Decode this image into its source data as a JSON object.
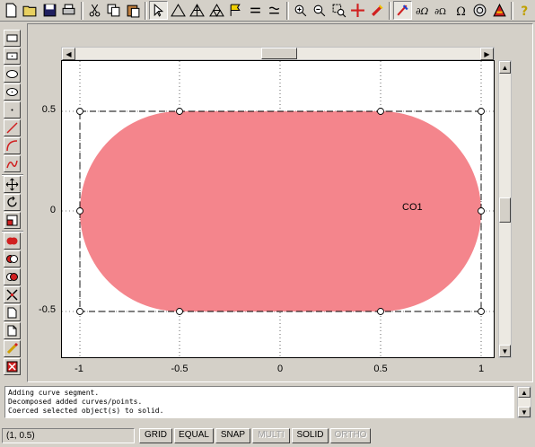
{
  "toolbar": {
    "buttons": [
      "new-icon",
      "open-icon",
      "save-icon",
      "print-icon",
      "cut-icon",
      "copy-icon",
      "paste-icon",
      "select-icon",
      "triangle-icon",
      "triangle-nodes-icon",
      "triangle-refine-icon",
      "flag-icon",
      "equals-icon",
      "approx-equal-icon",
      "zoom-in-icon",
      "zoom-out-icon",
      "zoom-window-icon",
      "cross-arrows-icon",
      "rocket-icon",
      "probe-icon",
      "pde-icon",
      "delta-omega-icon",
      "omega-icon",
      "circle-icon",
      "triangle-flag-icon",
      "help-icon"
    ]
  },
  "left_toolbar": {
    "buttons": [
      "rectangle-icon",
      "centered-rectangle-icon",
      "ellipse-icon",
      "centered-ellipse-icon",
      "point-icon",
      "line-icon",
      "arc-icon",
      "curve-icon",
      "move-icon",
      "rotate-icon",
      "scale-icon",
      "union-icon",
      "difference-icon",
      "intersection-icon",
      "split-icon",
      "page-icon",
      "page-folded-icon",
      "pencil-icon",
      "delete-icon"
    ]
  },
  "plot": {
    "x_ticks": [
      "-1",
      "-0.5",
      "0",
      "0.5",
      "1"
    ],
    "y_ticks": [
      "0.5",
      "0",
      "-0.5"
    ],
    "object_label": "CO1",
    "fill_color": "#f4858c"
  },
  "log": {
    "lines": [
      "Adding curve segment.",
      "Decomposed added curves/points.",
      "Coerced selected object(s) to solid."
    ]
  },
  "status": {
    "coord": "(1, 0.5)",
    "grid": "GRID",
    "equal": "EQUAL",
    "snap": "SNAP",
    "multi": "MULTI",
    "solid": "SOLID",
    "ortho": "ORTHO"
  }
}
